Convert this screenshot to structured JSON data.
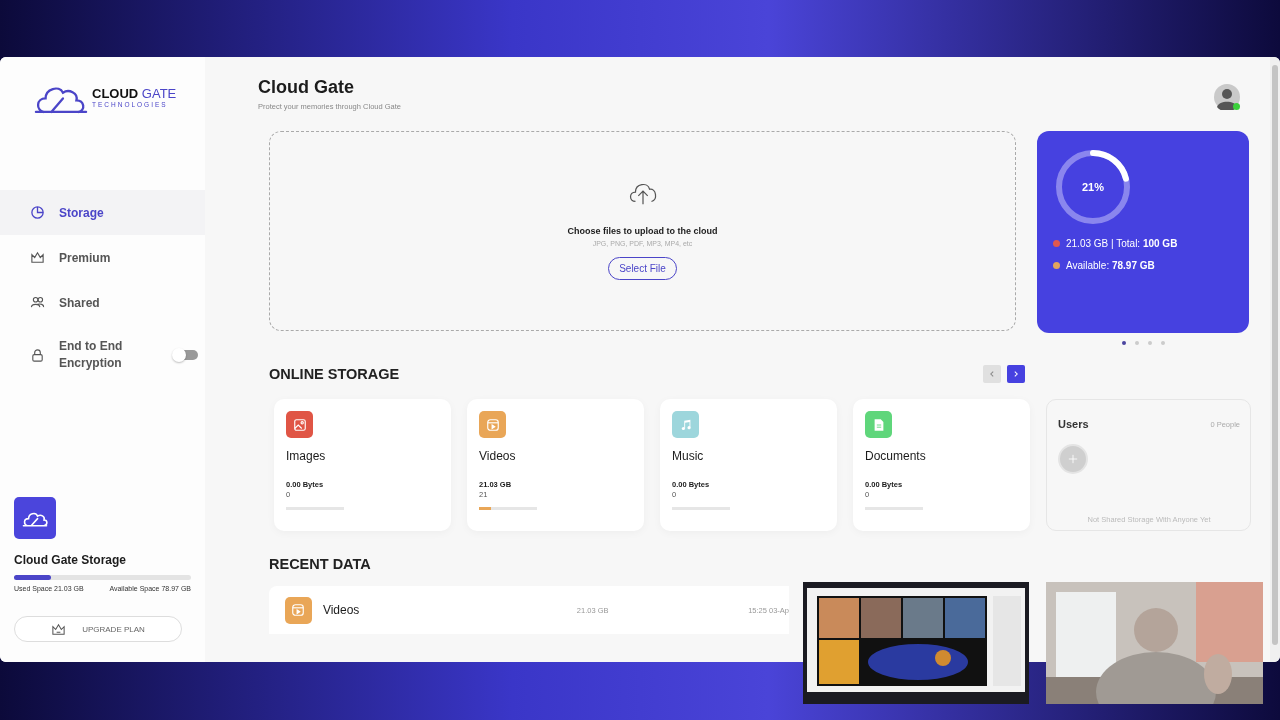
{
  "sidebar": {
    "logo": {
      "name": "CLOUD",
      "accent": "GATE",
      "tagline": "TECHNOLOGIES"
    },
    "items": [
      {
        "label": "Storage",
        "kind": "storage",
        "selected": true
      },
      {
        "label": "Premium",
        "kind": "premium",
        "selected": false
      },
      {
        "label": "Shared",
        "kind": "shared",
        "selected": false
      },
      {
        "label": "End to End Encryption",
        "kind": "encryption",
        "selected": false,
        "on": false
      }
    ],
    "storage_card": {
      "title": "Cloud Gate Storage",
      "level": 0.21,
      "used": "Used Space 21.03 GB",
      "available": "Available Space 78.97 GB"
    },
    "upgrade_button": "UPGRADE PLAN"
  },
  "header": {
    "title": "Cloud Gate",
    "subtitle": "Protect your memories through Cloud Gate",
    "avatar": {
      "online": true
    }
  },
  "upload": {
    "title": "Choose files to upload to the cloud",
    "formats": "JPG, PNG, PDF, MP3, MP4, etc",
    "button": "Select File"
  },
  "usage_card": {
    "percent": "21%",
    "level": 0.21,
    "legend": [
      {
        "text": "21.03 GB | Total: **100 GB**",
        "color": "#e0584e"
      },
      {
        "text": "Available: **78.97 GB**",
        "color": "#e2a45c"
      }
    ],
    "pages": [
      {
        "selected": true
      },
      {
        "selected": false
      },
      {
        "selected": false
      },
      {
        "selected": false
      }
    ]
  },
  "online_storage": {
    "title": "ONLINE STORAGE",
    "pager": [
      {
        "kind": "prev",
        "disabled": true
      },
      {
        "kind": "next",
        "disabled": false
      }
    ],
    "categories": [
      {
        "name": "Images",
        "kind": "images",
        "color": "#e05545",
        "size": "0.00 Bytes",
        "count": "0",
        "level": 0
      },
      {
        "name": "Videos",
        "kind": "videos",
        "color": "#e9a657",
        "size": "21.03 GB",
        "count": "21",
        "level": 0.21
      },
      {
        "name": "Music",
        "kind": "music",
        "color": "#9dd6dc",
        "size": "0.00 Bytes",
        "count": "0",
        "level": 0
      },
      {
        "name": "Documents",
        "kind": "documents",
        "color": "#5fd67b",
        "size": "0.00 Bytes",
        "count": "0",
        "level": 0
      }
    ],
    "users": {
      "title": "Users",
      "count": "0 People",
      "empty": "Not Shared Storage With Anyone Yet"
    }
  },
  "recent_data": {
    "title": "RECENT DATA",
    "rows": [
      {
        "name": "Videos",
        "kind": "videos",
        "color": "#e9a657",
        "size": "21.03 GB",
        "date": "15:25 03-Ap"
      }
    ]
  }
}
